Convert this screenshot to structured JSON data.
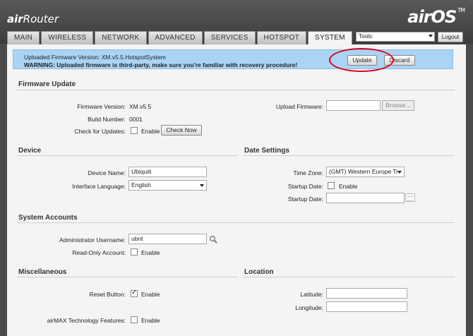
{
  "brand": {
    "prefix": "air",
    "name": "Router",
    "logo_air": "air",
    "logo_os": "OS",
    "logo_tm": "TM"
  },
  "tabs": [
    {
      "label": "MAIN"
    },
    {
      "label": "WIRELESS"
    },
    {
      "label": "NETWORK"
    },
    {
      "label": "ADVANCED"
    },
    {
      "label": "SERVICES"
    },
    {
      "label": "HOTSPOT"
    },
    {
      "label": "SYSTEM"
    }
  ],
  "active_tab": "SYSTEM",
  "tools": {
    "selected": "Tools:",
    "logout_label": "Logout"
  },
  "alert": {
    "line1": "Uploaded Firmware Version: XM.v5.5.HotspotSystem",
    "line2": "WARNING: Uploaded firmware is third-party, make sure you're familiar with recovery procedure!",
    "update_label": "Update",
    "discard_label": "Discard"
  },
  "firmware": {
    "title": "Firmware Update",
    "version_label": "Firmware Version:",
    "version_value": "XM.v5.5",
    "build_label": "Build Number:",
    "build_value": "0001",
    "check_label": "Check for Updates:",
    "check_enable": "Enable",
    "check_now_label": "Check Now",
    "upload_label": "Upload Firmware:",
    "browse_label": "Browse..."
  },
  "device": {
    "title": "Device",
    "name_label": "Device Name:",
    "name_value": "Ubiquiti",
    "lang_label": "Interface Language:",
    "lang_value": "English"
  },
  "date": {
    "title": "Date Settings",
    "tz_label": "Time Zone:",
    "tz_value": "(GMT) Western Europe Ti",
    "startup_label": "Startup Date:",
    "startup_enable": "Enable",
    "startup_date_label": "Startup Date:",
    "startup_date_value": ""
  },
  "accounts": {
    "title": "System Accounts",
    "admin_label": "Administrator Username:",
    "admin_value": "ubnt",
    "readonly_label": "Read-Only Account:",
    "readonly_enable": "Enable"
  },
  "misc": {
    "title": "Miscellaneous",
    "reset_label": "Reset Button:",
    "reset_enable": "Enable",
    "reset_checked": true,
    "airmax_label": "airMAX Technology Features:",
    "airmax_enable": "Enable"
  },
  "location": {
    "title": "Location",
    "lat_label": "Latitude:",
    "lat_value": "",
    "lon_label": "Longitude:",
    "lon_value": ""
  }
}
